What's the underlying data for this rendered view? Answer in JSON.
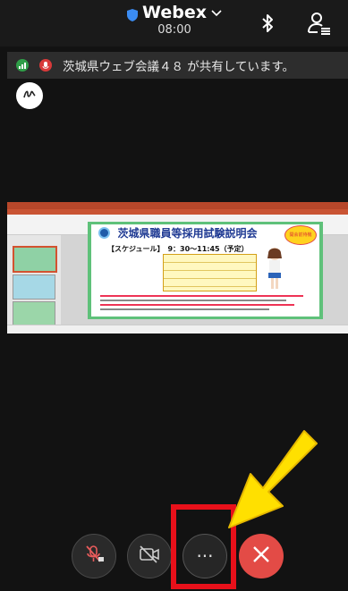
{
  "header": {
    "app_title": "Webex",
    "time": "08:00",
    "icons": [
      "shield-icon",
      "chevron-down-icon",
      "bluetooth-icon",
      "participants-icon"
    ]
  },
  "share_banner": {
    "text": "茨城県ウェブ会議４８ が共有しています。",
    "icons": [
      "signal-icon",
      "presenter-icon"
    ]
  },
  "annotation_button": {
    "icon": "pen-icon"
  },
  "shared_slide": {
    "title": "茨城県職員等採用試験説明会",
    "schedule": "【スケジュール】　9：30～11:45（予定）",
    "badge": "開会前待機"
  },
  "controls": {
    "icons": [
      "muted-microphone-icon",
      "video-off-icon",
      "more-options-icon",
      "leave-icon"
    ],
    "more_label": "···"
  },
  "highlight": {
    "box_color": "#e8101a",
    "arrow_color": "#ffe000"
  },
  "colors": {
    "leave": "#e34b46",
    "background": "#121212",
    "banner": "#2d2d2d"
  }
}
